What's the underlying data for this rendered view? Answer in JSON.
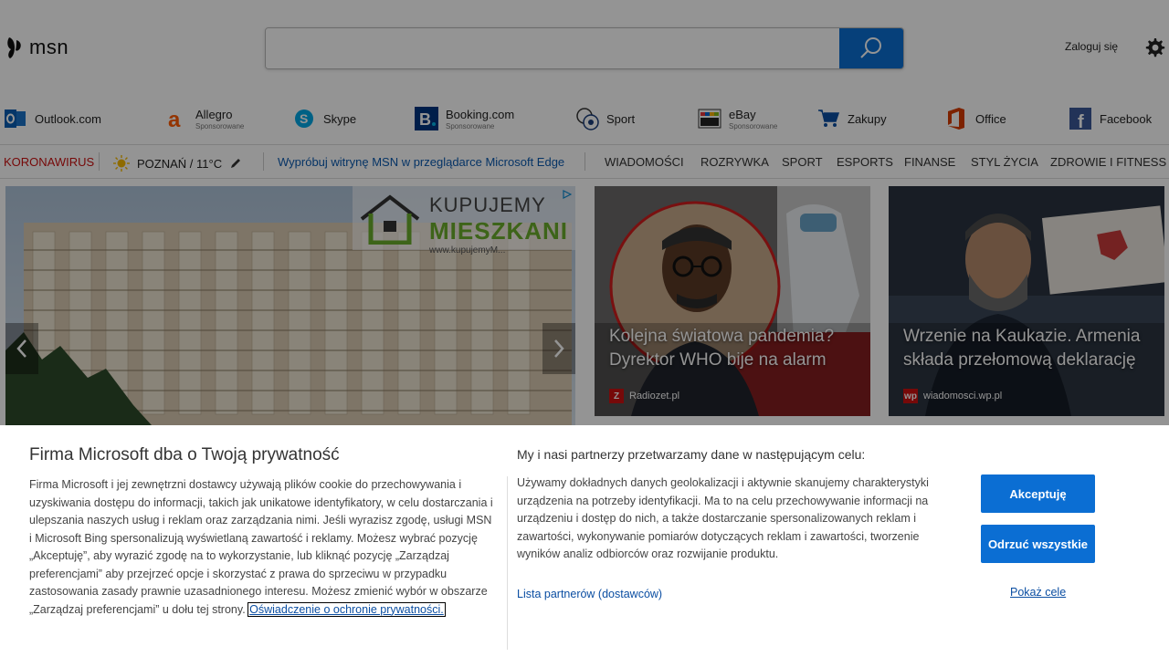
{
  "header": {
    "logo_text": "msn",
    "search": {
      "value": "",
      "placeholder": ""
    },
    "signin_label": "Zaloguj się"
  },
  "apps": [
    {
      "name": "Outlook.com",
      "sub": "",
      "icon": "outlook-icon"
    },
    {
      "name": "Allegro",
      "sub": "Sponsorowane",
      "icon": "allegro-icon"
    },
    {
      "name": "Skype",
      "sub": "",
      "icon": "skype-icon"
    },
    {
      "name": "Booking.com",
      "sub": "Sponsorowane",
      "icon": "booking-icon"
    },
    {
      "name": "Sport",
      "sub": "",
      "icon": "sport-icon"
    },
    {
      "name": "eBay",
      "sub": "Sponsorowane",
      "icon": "ebay-icon"
    },
    {
      "name": "Zakupy",
      "sub": "",
      "icon": "cart-icon"
    },
    {
      "name": "Office",
      "sub": "",
      "icon": "office-icon"
    },
    {
      "name": "Facebook",
      "sub": "",
      "icon": "facebook-icon"
    }
  ],
  "navbar": {
    "corona": "KORONAWIRUS",
    "weather": "POZNAŃ / 11°C",
    "edge_promo": "Wypróbuj witrynę MSN w przeglądarce Microsoft Edge",
    "links": [
      "WIADOMOŚCI",
      "ROZRYWKA",
      "SPORT",
      "ESPORTS",
      "FINANSE",
      "STYL ŻYCIA",
      "ZDROWIE I FITNESS"
    ]
  },
  "hero": {
    "ad_title_1": "KUPUJEMY",
    "ad_title_2": "MIESZKANI",
    "ad_url": "www.kupujemyM..."
  },
  "cards": [
    {
      "title": "Kolejna światowa pandemia? Dyrektor WHO bije na alarm",
      "source": "Radiozet.pl"
    },
    {
      "title": "Wrzenie na Kaukazie. Armenia składa przełomową deklarację",
      "source": "wiadomosci.wp.pl"
    }
  ],
  "consent": {
    "title": "Firma Microsoft dba o Twoją prywatność",
    "left_text": "Firma Microsoft i jej zewnętrzni dostawcy używają plików cookie do przechowywania i uzyskiwania dostępu do informacji, takich jak unikatowe identyfikatory, w celu dostarczania i ulepszania naszych usług i reklam oraz zarządzania nimi. Jeśli wyrazisz zgodę, usługi MSN i Microsoft Bing spersonalizują wyświetlaną zawartość i reklamy. Możesz wybrać pozycję „Akceptuję”, aby wyrazić zgodę na to wykorzystanie, lub kliknąć pozycję „Zarządzaj preferencjami” aby przejrzeć opcje i skorzystać z prawa do sprzeciwu w przypadku zastosowania zasady prawnie uzasadnionego interesu. Możesz zmienić wybór w obszarze „Zarządzaj preferencjami” u dołu tej strony.",
    "privacy_link": "Oświadczenie o ochronie prywatności.",
    "right_title": "My i nasi partnerzy przetwarzamy dane w następującym celu:",
    "right_text": "Używamy dokładnych danych geolokalizacji i aktywnie skanujemy charakterystyki urządzenia na potrzeby identyfikacji. Ma to na celu przechowywanie informacji na urządzeniu i dostęp do nich, a także dostarczanie spersonalizowanych reklam i zawartości, wykonywanie pomiarów dotyczących reklam i zawartości, tworzenie wyników analiz odbiorców oraz rozwijanie produktu.",
    "partners_link": "Lista partnerów (dostawców)",
    "accept_label": "Akceptuję",
    "reject_label": "Odrzuć wszystkie",
    "show_goals_label": "Pokaż cele"
  },
  "colors": {
    "accent": "#0b6ed3",
    "link": "#0b4ea2",
    "corona": "#cc1111"
  }
}
